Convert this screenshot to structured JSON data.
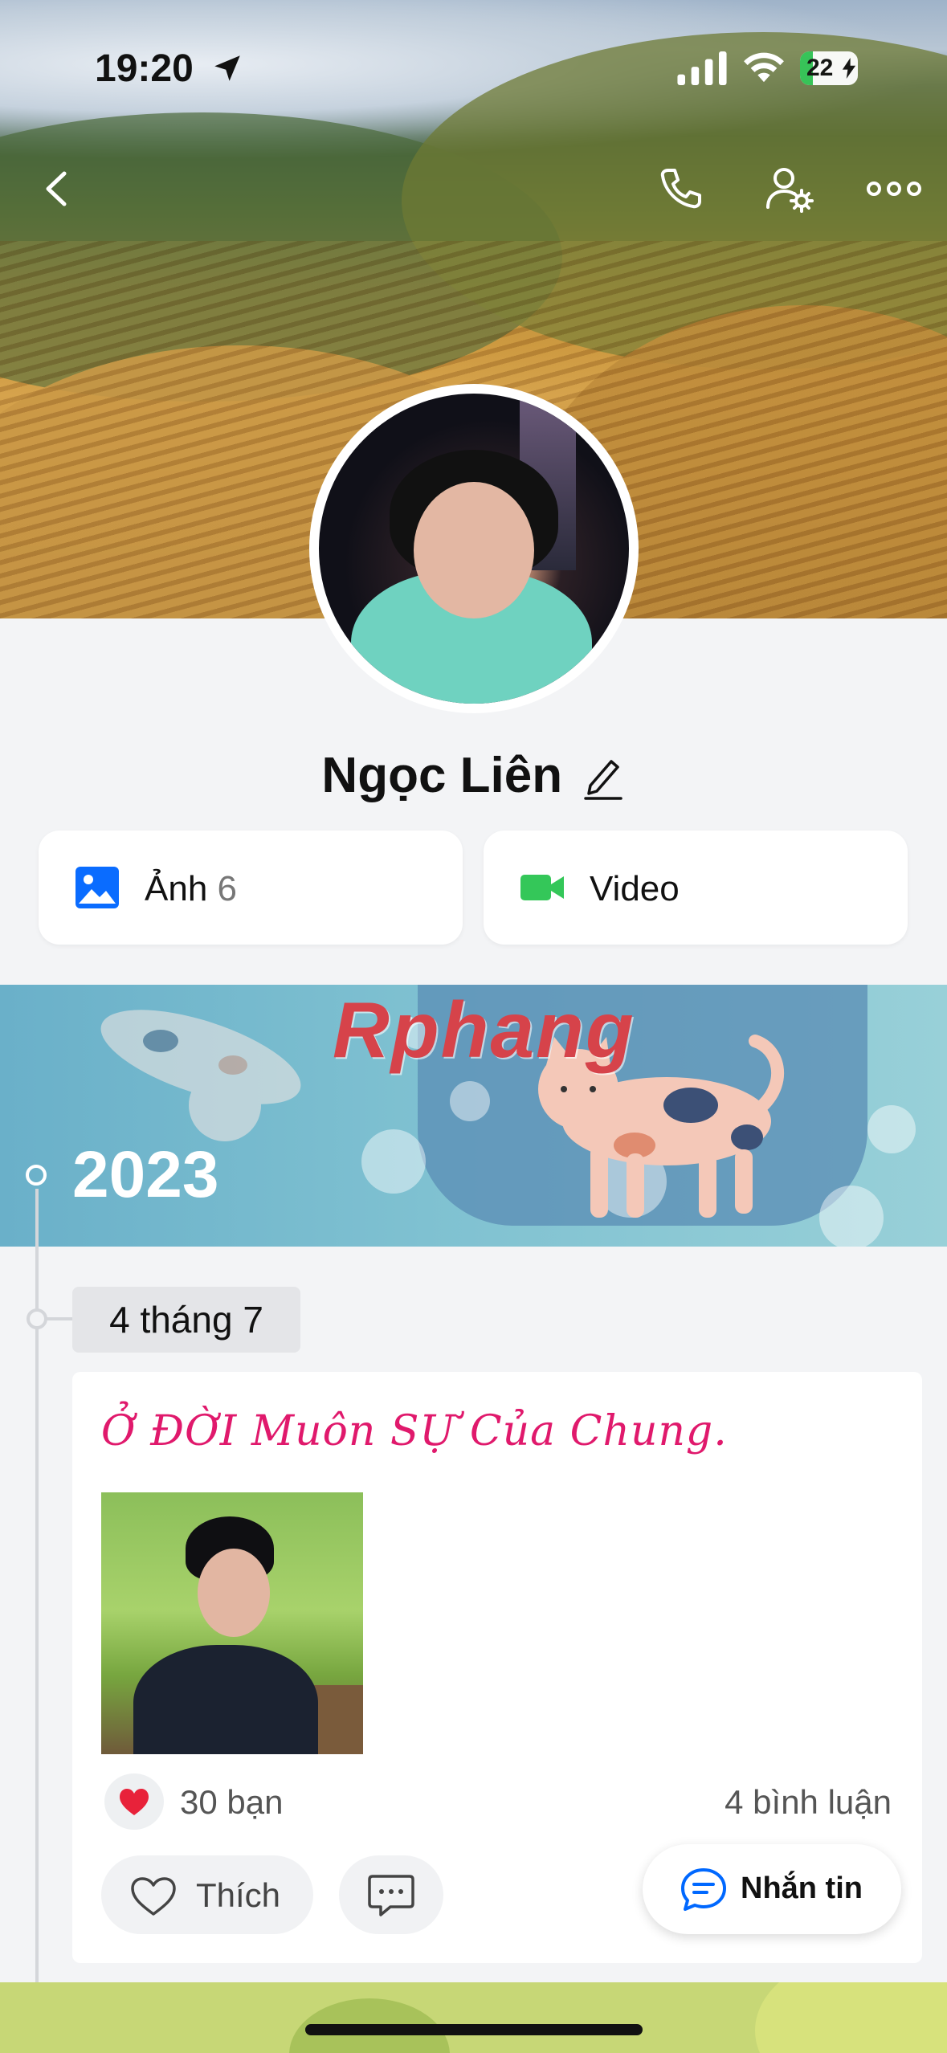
{
  "status_bar": {
    "time": "19:20",
    "battery": "22"
  },
  "icons": {
    "location": "location-arrow-icon",
    "signal": "cellular-signal-icon",
    "wifi": "wifi-icon",
    "battery": "battery-charging-icon",
    "back": "chevron-left-icon",
    "call": "phone-icon",
    "user_settings": "user-settings-icon",
    "more": "more-horizontal-icon",
    "edit": "pencil-icon",
    "photos": "image-icon",
    "video": "video-camera-icon",
    "reaction": "heart-icon",
    "like": "heart-outline-icon",
    "comment": "comment-icon",
    "message": "message-bubble-icon"
  },
  "profile": {
    "name": "Ngọc Liên"
  },
  "media_buttons": {
    "photos": {
      "label": "Ảnh",
      "count": "6"
    },
    "video": {
      "label": "Video"
    }
  },
  "timeline": {
    "watermark": "Rphang",
    "year": "2023",
    "date": "4 tháng 7"
  },
  "post": {
    "text": "Ở ĐỜI Muôn SỰ Của Chung.",
    "reactions": "30 bạn",
    "comments": "4 bình luận",
    "like_label": "Thích"
  },
  "fab": {
    "label": "Nhắn tin"
  },
  "colors": {
    "accent": "#0068ff",
    "post_text": "#e0196c",
    "video_green": "#34c759",
    "reaction_red": "#e8223a"
  }
}
